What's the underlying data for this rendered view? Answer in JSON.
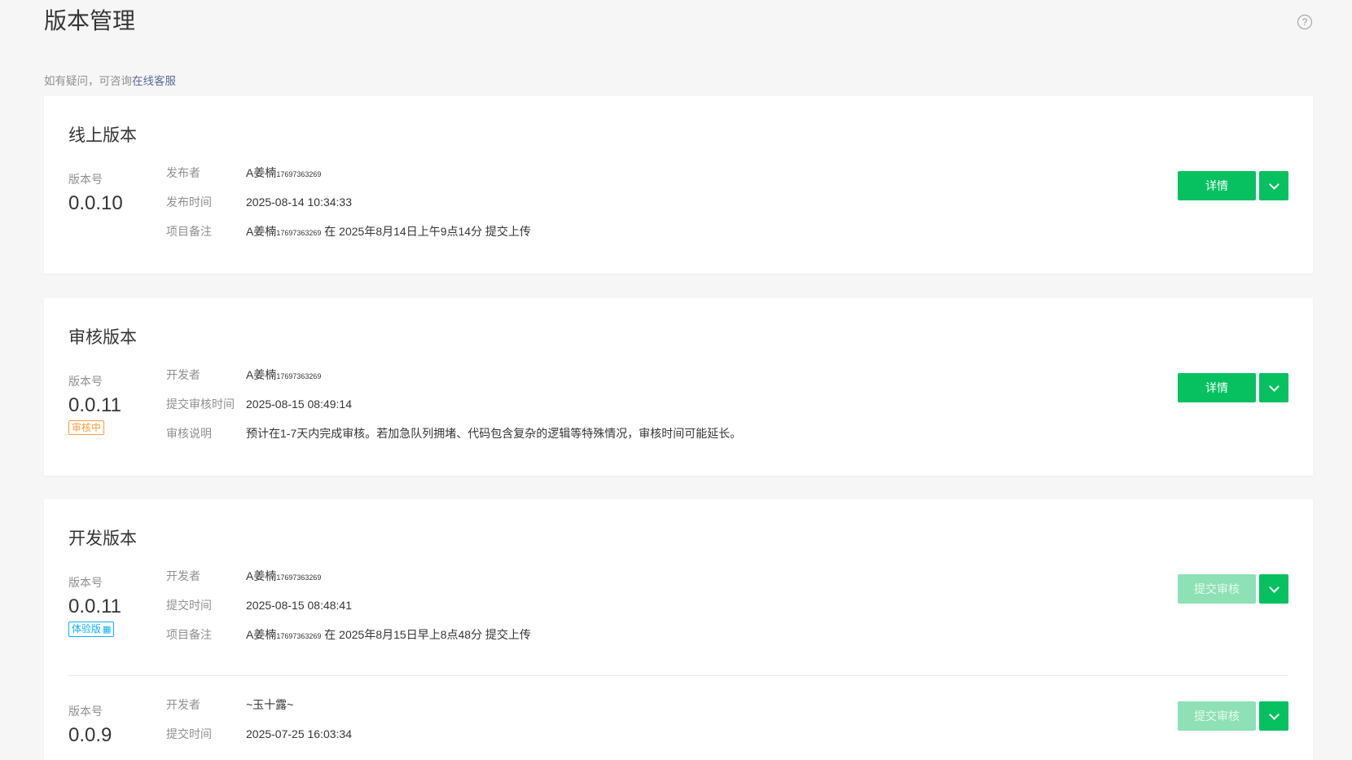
{
  "header": {
    "title": "版本管理",
    "notice_prefix": "如有疑问，可咨询",
    "notice_link": "在线客服",
    "help_glyph": "?"
  },
  "online": {
    "title": "线上版本",
    "version_label": "版本号",
    "version": "0.0.10",
    "rows": [
      {
        "label": "发布者",
        "name": "A姜楠",
        "phone": "17697363269",
        "text": ""
      },
      {
        "label": "发布时间",
        "name": "",
        "phone": "",
        "text": "2025-08-14 10:34:33"
      },
      {
        "label": "项目备注",
        "name": "A姜楠",
        "phone": "17697363269",
        "text": " 在 2025年8月14日上午9点14分 提交上传"
      }
    ],
    "primary_button": "详情"
  },
  "review": {
    "title": "审核版本",
    "version_label": "版本号",
    "version": "0.0.11",
    "tag": "审核中",
    "rows": [
      {
        "label": "开发者",
        "name": "A姜楠",
        "phone": "17697363269",
        "text": ""
      },
      {
        "label": "提交审核时间",
        "name": "",
        "phone": "",
        "text": "2025-08-15 08:49:14"
      },
      {
        "label": "审核说明",
        "name": "",
        "phone": "",
        "text": "预计在1-7天内完成审核。若加急队列拥堵、代码包含复杂的逻辑等特殊情况，审核时间可能延长。"
      }
    ],
    "primary_button": "详情"
  },
  "dev": {
    "title": "开发版本",
    "items": [
      {
        "version_label": "版本号",
        "version": "0.0.11",
        "tag": "体验版",
        "rows": [
          {
            "label": "开发者",
            "name": "A姜楠",
            "phone": "17697363269",
            "text": ""
          },
          {
            "label": "提交时间",
            "name": "",
            "phone": "",
            "text": "2025-08-15 08:48:41"
          },
          {
            "label": "项目备注",
            "name": "A姜楠",
            "phone": "17697363269",
            "text": " 在 2025年8月15日早上8点48分 提交上传"
          }
        ],
        "primary_button": "提交审核"
      },
      {
        "version_label": "版本号",
        "version": "0.0.9",
        "rows": [
          {
            "label": "开发者",
            "name": "~玉十露~",
            "phone": "",
            "text": ""
          },
          {
            "label": "提交时间",
            "name": "",
            "phone": "",
            "text": "2025-07-25 16:03:34"
          }
        ],
        "primary_button": "提交审核"
      }
    ]
  },
  "colors": {
    "accent": "#07c160",
    "link": "#576b95",
    "review_tag": "#fa9d3b",
    "trial_tag": "#10aeff"
  }
}
